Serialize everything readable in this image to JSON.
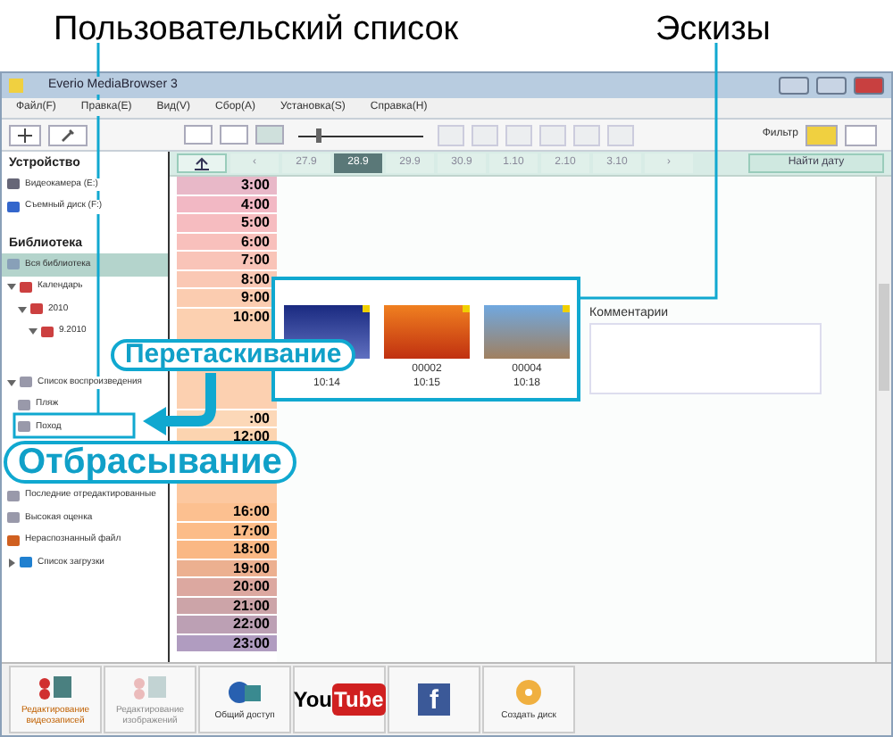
{
  "annotations": {
    "top_left": "Пользовательский список",
    "top_right": "Эскизы",
    "drag": "Перетаскивание",
    "drop": "Отбрасывание"
  },
  "window": {
    "title": "Everio MediaBrowser 3"
  },
  "menu": [
    "Файл(F)",
    "Правка(E)",
    "Вид(V)",
    "Сбор(A)",
    "Установка(S)",
    "Справка(H)"
  ],
  "toolbar": {
    "filter_label": "Фильтр",
    "zoom": {
      "level": 0.15
    }
  },
  "sidebar": {
    "sections": [
      {
        "title": "Устройство",
        "items": [
          {
            "label": "Видеокамера (E:)",
            "kind": "camera",
            "selected": false
          },
          {
            "label": "Съемный диск (F:)",
            "kind": "disk",
            "selected": false
          }
        ]
      },
      {
        "title": "Библиотека",
        "items": [
          {
            "label": "Вся библиотека",
            "kind": "library",
            "selected": true
          },
          {
            "label": "Календарь",
            "kind": "calendar",
            "selected": false,
            "expanded": true,
            "children": [
              {
                "label": "2010",
                "kind": "calendar",
                "selected": false,
                "expanded": true,
                "children": [
                  {
                    "label": "9.2010",
                    "kind": "calendar",
                    "selected": false,
                    "expanded": true
                  }
                ]
              }
            ]
          },
          {
            "label": "Список воспроизведения",
            "kind": "list",
            "selected": false,
            "expanded": true,
            "children": [
              {
                "label": "Пляж",
                "kind": "list",
                "selected": false
              },
              {
                "label": "Поход",
                "kind": "list",
                "selected": false
              }
            ]
          },
          {
            "label": "Последние отредактированные",
            "kind": "list",
            "selected": false
          },
          {
            "label": "Высокая оценка",
            "kind": "list",
            "selected": false
          },
          {
            "label": "Нераспознанный файл",
            "kind": "file",
            "selected": false
          },
          {
            "label": "Список загрузки",
            "kind": "globe",
            "selected": false,
            "expanded": false
          }
        ]
      }
    ]
  },
  "dates": [
    {
      "label": "‹",
      "selected": false
    },
    {
      "label": "27.9",
      "selected": false
    },
    {
      "label": "28.9",
      "selected": true
    },
    {
      "label": "29.9",
      "selected": false
    },
    {
      "label": "30.9",
      "selected": false
    },
    {
      "label": "1.10",
      "selected": false
    },
    {
      "label": "2.10",
      "selected": false
    },
    {
      "label": "3.10",
      "selected": false
    },
    {
      "label": "›",
      "selected": false
    }
  ],
  "find_date": "Найти дату",
  "hours": [
    {
      "label": "3:00",
      "color": "#e8b8c8",
      "expanded": false
    },
    {
      "label": "4:00",
      "color": "#f2b8c4",
      "expanded": false
    },
    {
      "label": "5:00",
      "color": "#f6bcc0",
      "expanded": false
    },
    {
      "label": "6:00",
      "color": "#f8c0bc",
      "expanded": false
    },
    {
      "label": "7:00",
      "color": "#f9c4b8",
      "expanded": false
    },
    {
      "label": "8:00",
      "color": "#fac8b4",
      "expanded": false
    },
    {
      "label": "9:00",
      "color": "#fbccb0",
      "expanded": false
    },
    {
      "label": "10:00",
      "color": "#fcd0b0",
      "expanded": true
    },
    {
      "label": ":00",
      "color": "#fcd8b8",
      "expanded": false
    },
    {
      "label": "12:00",
      "color": "#fcd4b0",
      "expanded": false
    },
    {
      "label": "16:00",
      "color": "#fcc090",
      "expanded": false
    },
    {
      "label": "17:00",
      "color": "#fcbc88",
      "expanded": false
    },
    {
      "label": "18:00",
      "color": "#fab884",
      "expanded": false
    },
    {
      "label": "19:00",
      "color": "#ecb090",
      "expanded": false
    },
    {
      "label": "20:00",
      "color": "#dca8a0",
      "expanded": false
    },
    {
      "label": "21:00",
      "color": "#cca4a8",
      "expanded": false
    },
    {
      "label": "22:00",
      "color": "#bca0b4",
      "expanded": false
    },
    {
      "label": "23:00",
      "color": "#b09cc0",
      "expanded": false
    }
  ],
  "thumbnails": [
    {
      "time": "10:14",
      "kind": "night"
    },
    {
      "name": "00002",
      "time": "10:15",
      "kind": "plane"
    },
    {
      "name": "00004",
      "time": "10:18",
      "kind": "pyramid"
    }
  ],
  "comment_label": "Комментарии",
  "bottom_buttons": [
    {
      "label": "Редактирование видеозаписей",
      "kind": "video",
      "disabled": false
    },
    {
      "label": "Редактирование изображений",
      "kind": "image",
      "disabled": true
    },
    {
      "label": "Общий доступ",
      "kind": "share",
      "disabled": false
    },
    {
      "kind": "youtube",
      "logo": "You",
      "logo2": "Tube",
      "disabled": false
    },
    {
      "kind": "facebook",
      "logo": "f",
      "disabled": false
    },
    {
      "label": "Создать диск",
      "kind": "disc",
      "disabled": false
    }
  ]
}
